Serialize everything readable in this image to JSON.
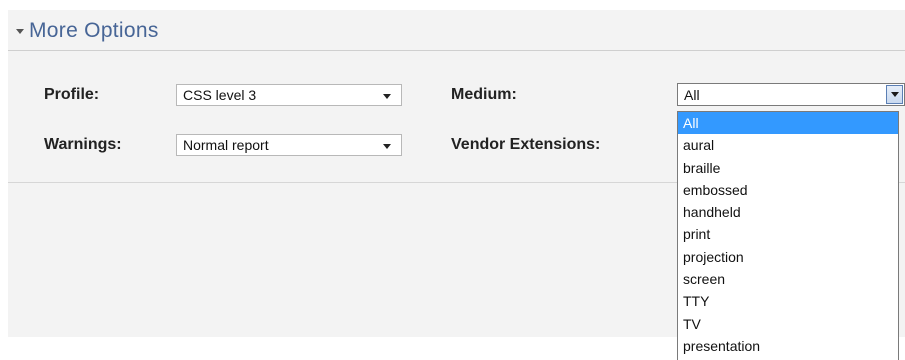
{
  "section": {
    "title": "More Options"
  },
  "profile": {
    "label": "Profile:",
    "value": "CSS level 3"
  },
  "warnings": {
    "label": "Warnings:",
    "value": "Normal report"
  },
  "medium": {
    "label": "Medium:",
    "value": "All",
    "options": [
      "All",
      "aural",
      "braille",
      "embossed",
      "handheld",
      "print",
      "projection",
      "screen",
      "TTY",
      "TV",
      "presentation"
    ],
    "highlighted": "All"
  },
  "vendor_extensions": {
    "label": "Vendor Extensions:"
  },
  "colors": {
    "panel_bg": "#f3f3f3",
    "title": "#476596",
    "highlight": "#3399ff"
  }
}
